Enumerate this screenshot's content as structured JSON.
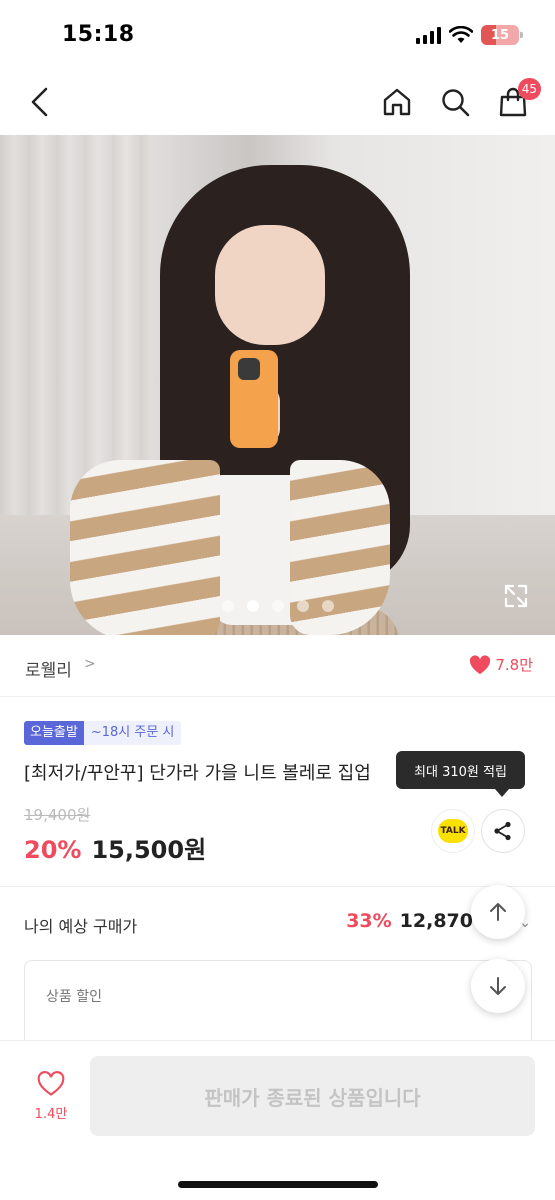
{
  "status_bar": {
    "time": "15:18",
    "battery": "15"
  },
  "nav": {
    "cart_count": "45"
  },
  "product_image": {
    "page_index": 1,
    "page_count": 5
  },
  "brand": {
    "name": "로웰리",
    "chevron": ">",
    "like_count": "7.8만"
  },
  "product": {
    "badge_today": "오늘출발",
    "badge_time": "~18시 주문 시",
    "title": "[최저가/꾸안꾸] 단가라 가을 니트 볼레로 집업",
    "original_price": "19,400원",
    "discount": "20%",
    "price": "15,500원",
    "talk_label": "TALK",
    "tooltip": "최대 310원 적립"
  },
  "expected": {
    "label": "나의 예상 구매가",
    "rate": "33%",
    "price": "12,870",
    "chevron": "⌄",
    "discount_label": "상품 할인"
  },
  "bottom": {
    "wish_count": "1.4만",
    "sold_out_label": "판매가 종료된 상품입니다"
  },
  "colors": {
    "accent": "#ef4a5e",
    "badge": "#5a67d8",
    "kakao": "#f9e000"
  }
}
